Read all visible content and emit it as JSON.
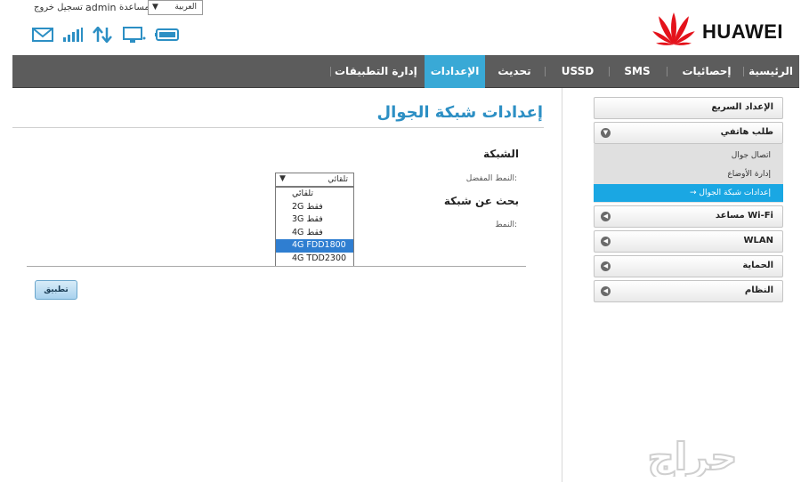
{
  "topbar": {
    "logout": "تسجيل خروج",
    "username": "admin",
    "help": "مساعدة",
    "language": "العربية"
  },
  "status_icons": [
    "envelope-icon",
    "signal-bars-icon",
    "data-transfer-icon",
    "monitor-icon",
    "battery-icon"
  ],
  "brand": {
    "logo_text": "HUAWEI",
    "accent": "#e4121b"
  },
  "nav": {
    "items": [
      "الرئيسية",
      "إحصائيات",
      "SMS",
      "USSD",
      "تحديث",
      "الإعدادات",
      "إدارة التطبيقات"
    ],
    "active_index": 5,
    "bg": "#5c5c5c",
    "active_bg": "#39a9d6"
  },
  "page": {
    "title": "إعدادات شبكة الجوال",
    "network_heading": "الشبكة",
    "preferred_mode_label": "النمط المفضل:",
    "selected_mode": "تلقائي",
    "search_heading": "بحث عن شبكة",
    "mode_label": "النمط:",
    "apply_label": "تطبيق"
  },
  "dropdown": {
    "options": [
      "تلقائي",
      "2G فقط",
      "3G فقط",
      "4G فقط",
      "4G FDD1800",
      "4G TDD2300"
    ],
    "highlighted": "4G FDD1800",
    "highlight_color": "#2f7ed1"
  },
  "sidebar": {
    "quick_setup": "الإعداد السريع",
    "dial_up": "طلب هاتفي",
    "sub_items": [
      "اتصال جوال",
      "إدارة الأوضاع",
      "إعدادات شبكة الجوال"
    ],
    "active_sub": "إعدادات شبكة الجوال",
    "wifi_assistant": "مساعد Wi-Fi",
    "wlan": "WLAN",
    "security": "الحماية",
    "system": "النظام",
    "active_color": "#1aa7e3"
  },
  "watermark": "حراج"
}
